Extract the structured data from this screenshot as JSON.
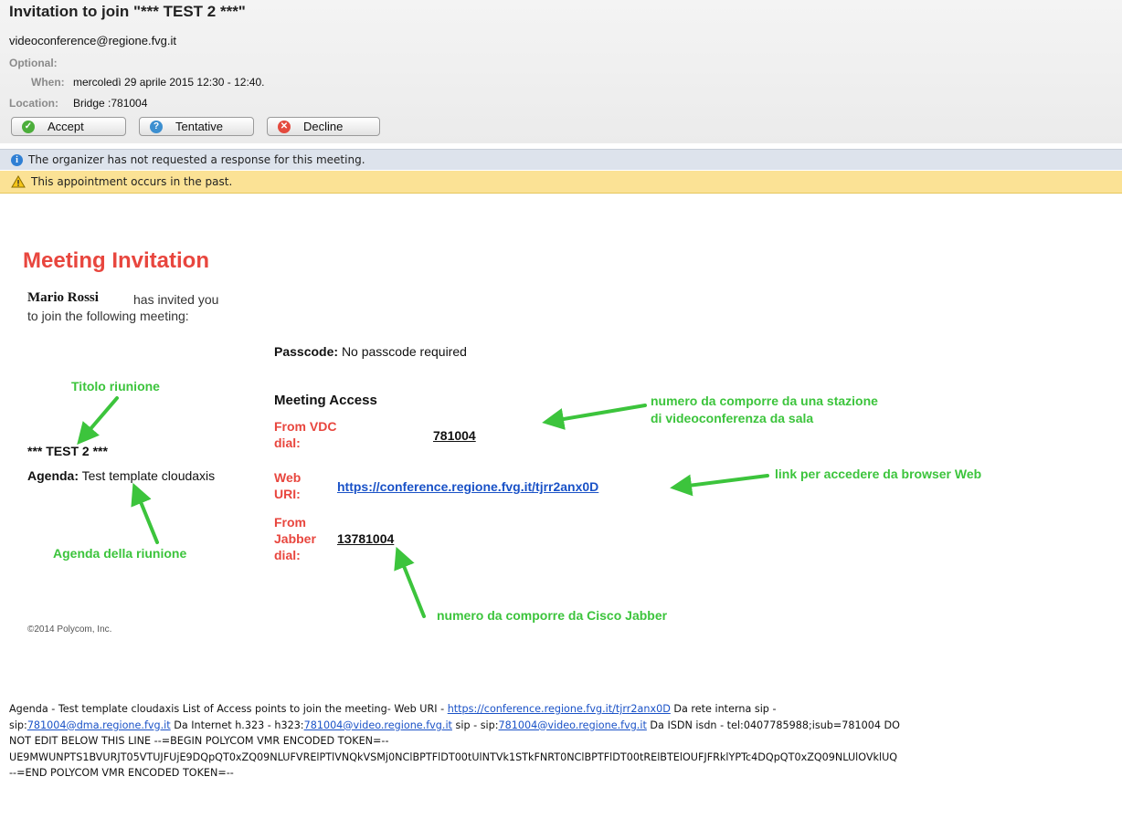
{
  "header": {
    "title": "Invitation to join \"*** TEST 2 ***\"",
    "from": "videoconference@regione.fvg.it",
    "optional_label": "Optional:",
    "when_label": "When:",
    "when_value": "mercoledì 29 aprile 2015 12:30 - 12:40.",
    "location_label": "Location:",
    "location_value": "Bridge :781004",
    "buttons": {
      "accept": "Accept",
      "tentative": "Tentative",
      "decline": "Decline"
    },
    "info_message": "The organizer has not requested a response for this meeting.",
    "warning_message": "This appointment occurs in the past."
  },
  "invitation": {
    "title": "Meeting Invitation",
    "organizer": "Mario Rossi",
    "invited_text": "has invited you",
    "follow_text": "to join the following meeting:",
    "passcode_label": "Passcode:",
    "passcode_value": "No passcode required",
    "meeting_title": "*** TEST 2 ***",
    "agenda_label": "Agenda:",
    "agenda_value": "Test template cloudaxis",
    "access_heading": "Meeting Access",
    "vdc_label": "From VDC dial:",
    "vdc_number": "781004",
    "web_label": "Web URI:",
    "web_uri": "https://conference.regione.fvg.it/tjrr2anx0D",
    "jabber_label": "From Jabber dial:",
    "jabber_number": "13781004",
    "copyright": "©2014 Polycom, Inc."
  },
  "annotations": {
    "titolo": "Titolo riunione",
    "agenda": "Agenda della riunione",
    "vdc": "numero da comporre da una stazione di videoconferenza da sala",
    "vdc_line1": "numero da comporre da una stazione",
    "vdc_line2": "di videoconferenza da sala",
    "web": "link per accedere da browser Web",
    "cisco": "numero da comporre da Cisco Jabber",
    "arrow_color": "#3cc43c"
  },
  "footer": {
    "l1_a": "Agenda - Test template cloudaxis List of Access points to join the meeting- Web URI - ",
    "l1_link": "https://conference.regione.fvg.it/tjrr2anx0D",
    "l1_b": " Da rete interna sip -",
    "l2_a": "sip:",
    "l2_link1": "781004@dma.regione.fvg.it",
    "l2_b": " Da Internet h.323 - h323:",
    "l2_link2": "781004@video.regione.fvg.it",
    "l2_c": " sip - sip:",
    "l2_link3": "781004@video.regione.fvg.it",
    "l2_d": " Da ISDN isdn - tel:0407785988;isub=781004 DO",
    "l3": "NOT EDIT BELOW THIS LINE --=BEGIN POLYCOM VMR ENCODED TOKEN=--",
    "l4": "UE9MWUNPTS1BVURJT05VTUJFUjE9DQpQT0xZQ09NLUFVRElPTlVNQkVSMj0NClBPTFlDT00tUlNTVk1STkFNRT0NClBPTFlDT00tRElBTElOUFJFRklYPTc4DQpQT0xZQ09NLUlOVklUQ",
    "l5": "--=END POLYCOM VMR ENCODED TOKEN=--"
  },
  "colors": {
    "accent_red": "#e8463e",
    "link_blue": "#1a52c7",
    "annotation_green": "#3cc43c",
    "warning_bg": "#fbe295",
    "info_bg": "#dde3ec"
  }
}
